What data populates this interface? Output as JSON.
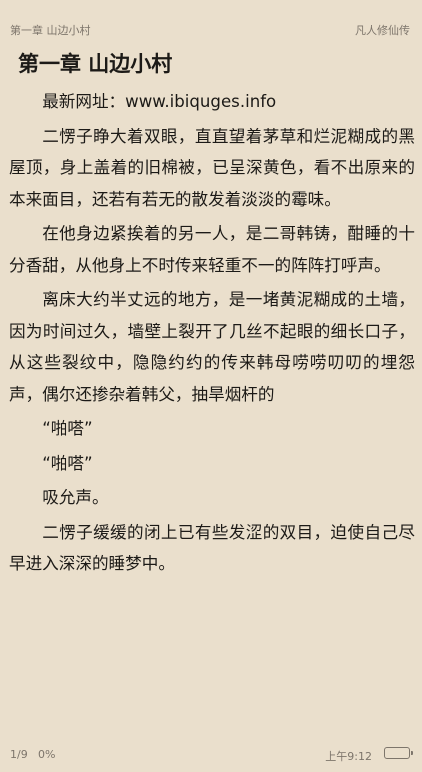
{
  "header": {
    "chapter": "第一章 山边小村",
    "book_title": "凡人修仙传"
  },
  "chapter_title": "第一章 山边小村",
  "paragraphs": [
    "最新网址：www.ibiquges.info",
    "二愣子睁大着双眼，直直望着茅草和烂泥糊成的黑屋顶，身上盖着的旧棉被，已呈深黄色，看不出原来的本来面目，还若有若无的散发着淡淡的霉味。",
    "在他身边紧挨着的另一人，是二哥韩铸，酣睡的十分香甜，从他身上不时传来轻重不一的阵阵打呼声。",
    "离床大约半丈远的地方，是一堵黄泥糊成的土墙，因为时间过久，墙壁上裂开了几丝不起眼的细长口子，从这些裂纹中，隐隐约约的传来韩母唠唠叨叨的埋怨声，偶尔还掺杂着韩父，抽旱烟杆的",
    "“啪嗒”",
    "“啪嗒”",
    "吸允声。",
    "二愣子缓缓的闭上已有些发涩的双目，迫使自己尽早进入深深的睡梦中。"
  ],
  "footer": {
    "page": "1/9",
    "progress": "0%",
    "time": "上午9:12",
    "battery_icon": "battery-icon"
  }
}
